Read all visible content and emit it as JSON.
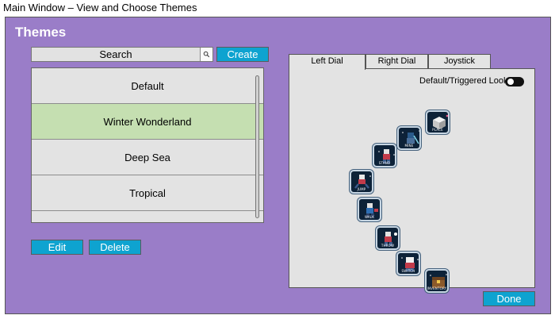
{
  "window": {
    "title": "Main Window – View and Choose Themes"
  },
  "themes_panel": {
    "heading": "Themes",
    "search": {
      "value": "Search",
      "icon": "search-icon"
    },
    "create_label": "Create",
    "items": [
      {
        "label": "Default",
        "selected": false
      },
      {
        "label": "Winter Wonderland",
        "selected": true
      },
      {
        "label": "Deep Sea",
        "selected": false
      },
      {
        "label": "Tropical",
        "selected": false
      },
      {
        "label": "",
        "selected": false
      }
    ],
    "edit_label": "Edit",
    "delete_label": "Delete"
  },
  "tabs": [
    {
      "label": "Left Dial",
      "active": true
    },
    {
      "label": "Right Dial",
      "active": false
    },
    {
      "label": "Joystick",
      "active": false
    }
  ],
  "dial": {
    "look_label": "Default/Triggered Look",
    "toggle_on": false,
    "icons": [
      {
        "name": "place-icon",
        "caption": "PLACE"
      },
      {
        "name": "mine-icon",
        "caption": "MINE"
      },
      {
        "name": "stand-icon",
        "caption": "STAND"
      },
      {
        "name": "jump-icon",
        "caption": "JUMP"
      },
      {
        "name": "walk-icon",
        "caption": "WALK"
      },
      {
        "name": "throw-icon",
        "caption": "THROW"
      },
      {
        "name": "switch-icon",
        "caption": "SWITCH"
      },
      {
        "name": "inventory-icon",
        "caption": "INVENTORY"
      }
    ]
  },
  "done_label": "Done",
  "colors": {
    "frame": "#9a7dc8",
    "button": "#0ea3d0",
    "selected_item": "#c5dfb1",
    "panel": "#e3e3e3"
  }
}
